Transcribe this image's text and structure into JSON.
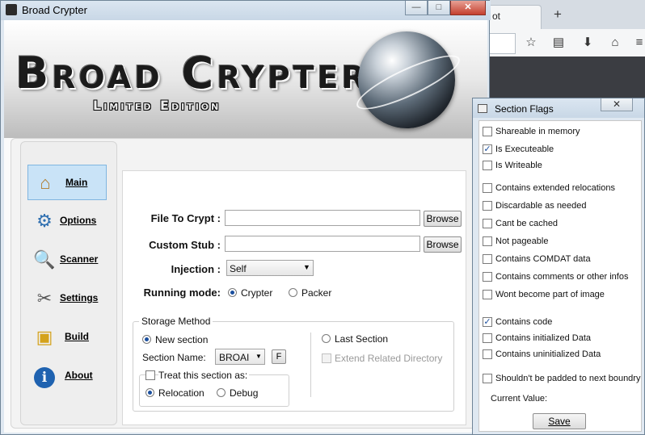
{
  "background_browser": {
    "tab_label": "ot",
    "new_tab_symbol": "+"
  },
  "window": {
    "title": "Broad Crypter",
    "minimize": "—",
    "maximize": "□",
    "close": "✕"
  },
  "banner": {
    "title": "Broad Crypter",
    "subtitle": "Limited Edition"
  },
  "nav": {
    "items": [
      {
        "label": "Main",
        "icon": "home-icon",
        "active": true
      },
      {
        "label": "Options",
        "icon": "gear-icon",
        "active": false
      },
      {
        "label": "Scanner",
        "icon": "magnifier-icon",
        "active": false
      },
      {
        "label": "Settings",
        "icon": "tools-icon",
        "active": false
      },
      {
        "label": "Build",
        "icon": "build-icon",
        "active": false
      },
      {
        "label": "About",
        "icon": "info-icon",
        "active": false
      }
    ]
  },
  "main": {
    "file_to_crypt_label": "File To Crypt :",
    "file_to_crypt_value": "",
    "custom_stub_label": "Custom Stub :",
    "custom_stub_value": "",
    "browse_label": "Browse",
    "injection_label": "Injection :",
    "injection_value": "Self",
    "running_mode_label": "Running mode:",
    "running_mode_options": [
      "Crypter",
      "Packer"
    ],
    "running_mode_selected": "Crypter",
    "storage_method_label": "Storage Method",
    "new_section_label": "New section",
    "last_section_label": "Last Section",
    "section_name_label": "Section Name:",
    "section_name_value": "BROAI",
    "f_button_label": "F",
    "extend_related_directory_label": "Extend Related Directory",
    "treat_section_label": "Treat this section as:",
    "relocation_label": "Relocation",
    "debug_label": "Debug"
  },
  "flags": {
    "title": "Section Flags",
    "close": "✕",
    "items": [
      {
        "label": "Shareable in memory",
        "checked": false
      },
      {
        "label": "Is Executeable",
        "checked": true
      },
      {
        "label": "Is Writeable",
        "checked": false
      },
      {
        "label": "Contains extended relocations",
        "checked": false
      },
      {
        "label": "Discardable as needed",
        "checked": false
      },
      {
        "label": "Cant be cached",
        "checked": false
      },
      {
        "label": "Not pageable",
        "checked": false
      },
      {
        "label": "Contains COMDAT data",
        "checked": false
      },
      {
        "label": "Contains comments or other infos",
        "checked": false
      },
      {
        "label": "Wont become part of image",
        "checked": false
      },
      {
        "label": "Contains code",
        "checked": true
      },
      {
        "label": "Contains initialized Data",
        "checked": false
      },
      {
        "label": "Contains uninitialized Data",
        "checked": false
      },
      {
        "label": "Shouldn't be padded to next boundry",
        "checked": false
      }
    ],
    "current_value_label": "Current Value:",
    "current_value": "",
    "save_label": "Save"
  }
}
